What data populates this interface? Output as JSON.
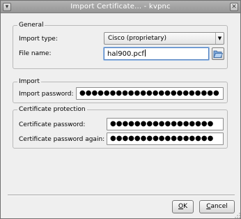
{
  "window": {
    "title": "Import Certificate... - kvpnc",
    "menu_glyph": "▾",
    "close_glyph": "✕"
  },
  "general": {
    "legend": "General",
    "import_type_label": "Import type:",
    "import_type_value": "Cisco (proprietary)",
    "dropdown_glyph": "▼",
    "file_name_label": "File name:",
    "file_name_value": "hal900.pcf"
  },
  "import": {
    "legend": "Import",
    "password_label": "Import password:",
    "password_mask": "●●●●●●●●●●●●●●●●●●●●●●●"
  },
  "cert_protection": {
    "legend": "Certificate protection",
    "password_label": "Certificate password:",
    "password_mask": "●●●●●●●●●●●●●●●●●",
    "password_again_label": "Certificate password again:",
    "password_again_mask": "●●●●●●●●●●●●●●●●●"
  },
  "buttons": {
    "ok_mnemonic": "O",
    "ok_rest": "K",
    "cancel_mnemonic": "C",
    "cancel_rest": "ancel"
  },
  "icons": {
    "browse": "folder-open-icon",
    "window_menu": "window-menu-icon",
    "close": "close-icon",
    "resize": "resize-grip-icon"
  },
  "colors": {
    "titlebar": "#a4a4a4",
    "window_bg": "#efefef",
    "focus_border": "#4f7fc0"
  }
}
